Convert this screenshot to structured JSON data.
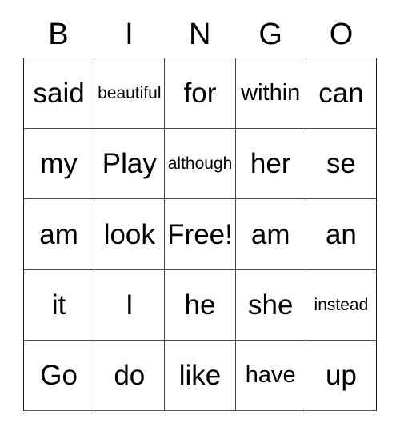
{
  "card": {
    "title": "BINGO",
    "headers": [
      "B",
      "I",
      "N",
      "G",
      "O"
    ],
    "rows": [
      [
        {
          "text": "said",
          "size": "lg"
        },
        {
          "text": "beautiful",
          "size": "sm"
        },
        {
          "text": "for",
          "size": "lg"
        },
        {
          "text": "within",
          "size": "md"
        },
        {
          "text": "can",
          "size": "lg"
        }
      ],
      [
        {
          "text": "my",
          "size": "lg"
        },
        {
          "text": "Play",
          "size": "lg"
        },
        {
          "text": "although",
          "size": "sm"
        },
        {
          "text": "her",
          "size": "lg"
        },
        {
          "text": "se",
          "size": "lg"
        }
      ],
      [
        {
          "text": "am",
          "size": "lg"
        },
        {
          "text": "look",
          "size": "lg"
        },
        {
          "text": "Free!",
          "size": "lg"
        },
        {
          "text": "am",
          "size": "lg"
        },
        {
          "text": "an",
          "size": "lg"
        }
      ],
      [
        {
          "text": "it",
          "size": "lg"
        },
        {
          "text": "I",
          "size": "lg"
        },
        {
          "text": "he",
          "size": "lg"
        },
        {
          "text": "she",
          "size": "lg"
        },
        {
          "text": "instead",
          "size": "sm"
        }
      ],
      [
        {
          "text": "Go",
          "size": "lg"
        },
        {
          "text": "do",
          "size": "lg"
        },
        {
          "text": "like",
          "size": "lg"
        },
        {
          "text": "have",
          "size": "md"
        },
        {
          "text": "up",
          "size": "lg"
        }
      ]
    ],
    "free_space": {
      "row": 2,
      "col": 2,
      "label": "Free!"
    },
    "colors": {
      "text": "#000000",
      "grid_line": "#4a4a4a",
      "background": "#ffffff"
    }
  }
}
